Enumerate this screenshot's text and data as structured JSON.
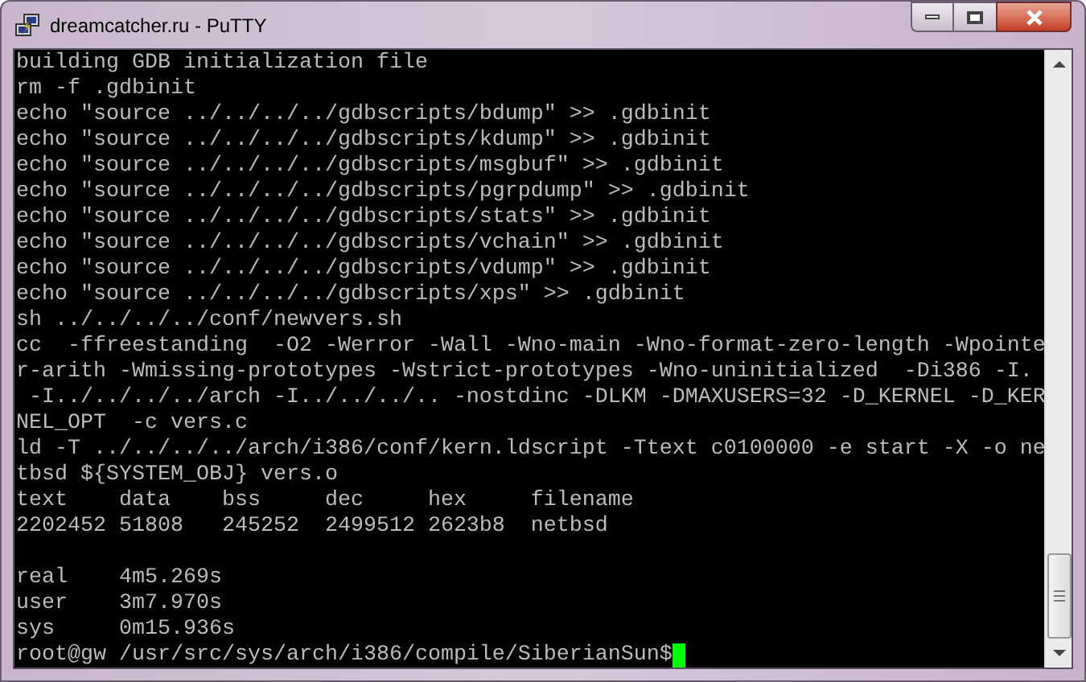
{
  "window": {
    "title": "dreamcatcher.ru - PuTTY"
  },
  "terminal": {
    "blocks": [
      [
        "building GDB initialization file",
        "rm -f .gdbinit",
        "echo \"source ../../../../gdbscripts/bdump\" >> .gdbinit",
        "echo \"source ../../../../gdbscripts/kdump\" >> .gdbinit",
        "echo \"source ../../../../gdbscripts/msgbuf\" >> .gdbinit",
        "echo \"source ../../../../gdbscripts/pgrpdump\" >> .gdbinit",
        "echo \"source ../../../../gdbscripts/stats\" >> .gdbinit",
        "echo \"source ../../../../gdbscripts/vchain\" >> .gdbinit",
        "echo \"source ../../../../gdbscripts/vdump\" >> .gdbinit",
        "echo \"source ../../../../gdbscripts/xps\" >> .gdbinit",
        "sh ../../../../conf/newvers.sh",
        "cc  -ffreestanding  -O2 -Werror -Wall -Wno-main -Wno-format-zero-length -Wpointe",
        "r-arith -Wmissing-prototypes -Wstrict-prototypes -Wno-uninitialized  -Di386 -I.",
        " -I../../../../arch -I../../../.. -nostdinc -DLKM -DMAXUSERS=32 -D_KERNEL -D_KER",
        "NEL_OPT  -c vers.c",
        "ld -T ../../../../arch/i386/conf/kern.ldscript -Ttext c0100000 -e start -X -o ne",
        "tbsd ${SYSTEM_OBJ} vers.o",
        "text    data    bss     dec     hex     filename",
        "2202452 51808   245252  2499512 2623b8  netbsd"
      ],
      [
        "real    4m5.269s",
        "user    3m7.970s",
        "sys     0m15.936s"
      ]
    ],
    "prompt": "root@gw /usr/src/sys/arch/i386/compile/SiberianSun$"
  }
}
